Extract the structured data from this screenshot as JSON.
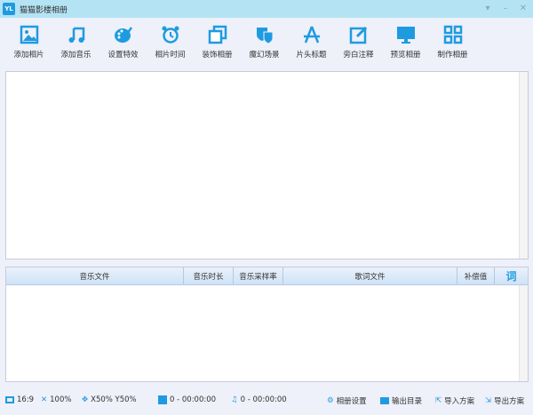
{
  "window": {
    "logo": "YL",
    "title": "猫猫影楼相册",
    "controls": [
      "▾",
      "–",
      "✕"
    ]
  },
  "toolbar": [
    {
      "label": "添加相片",
      "icon": "image-icon"
    },
    {
      "label": "添加音乐",
      "icon": "music-icon"
    },
    {
      "label": "设置特效",
      "icon": "palette-icon"
    },
    {
      "label": "相片时间",
      "icon": "alarm-clock-icon"
    },
    {
      "label": "装饰相册",
      "icon": "frames-icon"
    },
    {
      "label": "魔幻场景",
      "icon": "masks-icon"
    },
    {
      "label": "片头标题",
      "icon": "appstore-icon"
    },
    {
      "label": "旁白注释",
      "icon": "edit-icon"
    },
    {
      "label": "预览相册",
      "icon": "monitor-icon"
    },
    {
      "label": "制作相册",
      "icon": "grid-icon"
    }
  ],
  "music_table": {
    "columns": [
      "音乐文件",
      "音乐时长",
      "音乐采样率",
      "歌词文件",
      "补偿值"
    ],
    "lyric_icon": "词"
  },
  "status": {
    "ratio": "16:9",
    "zoom": "100%",
    "position": "X50% Y50%",
    "photos": "0 - 00:00:00",
    "music": "0 - 00:00:00",
    "settings": "相册设置",
    "output_dir": "输出目录",
    "import": "导入方案",
    "export": "导出方案"
  },
  "colors": {
    "accent": "#1e9be0",
    "titlebar": "#b4e4f4"
  }
}
